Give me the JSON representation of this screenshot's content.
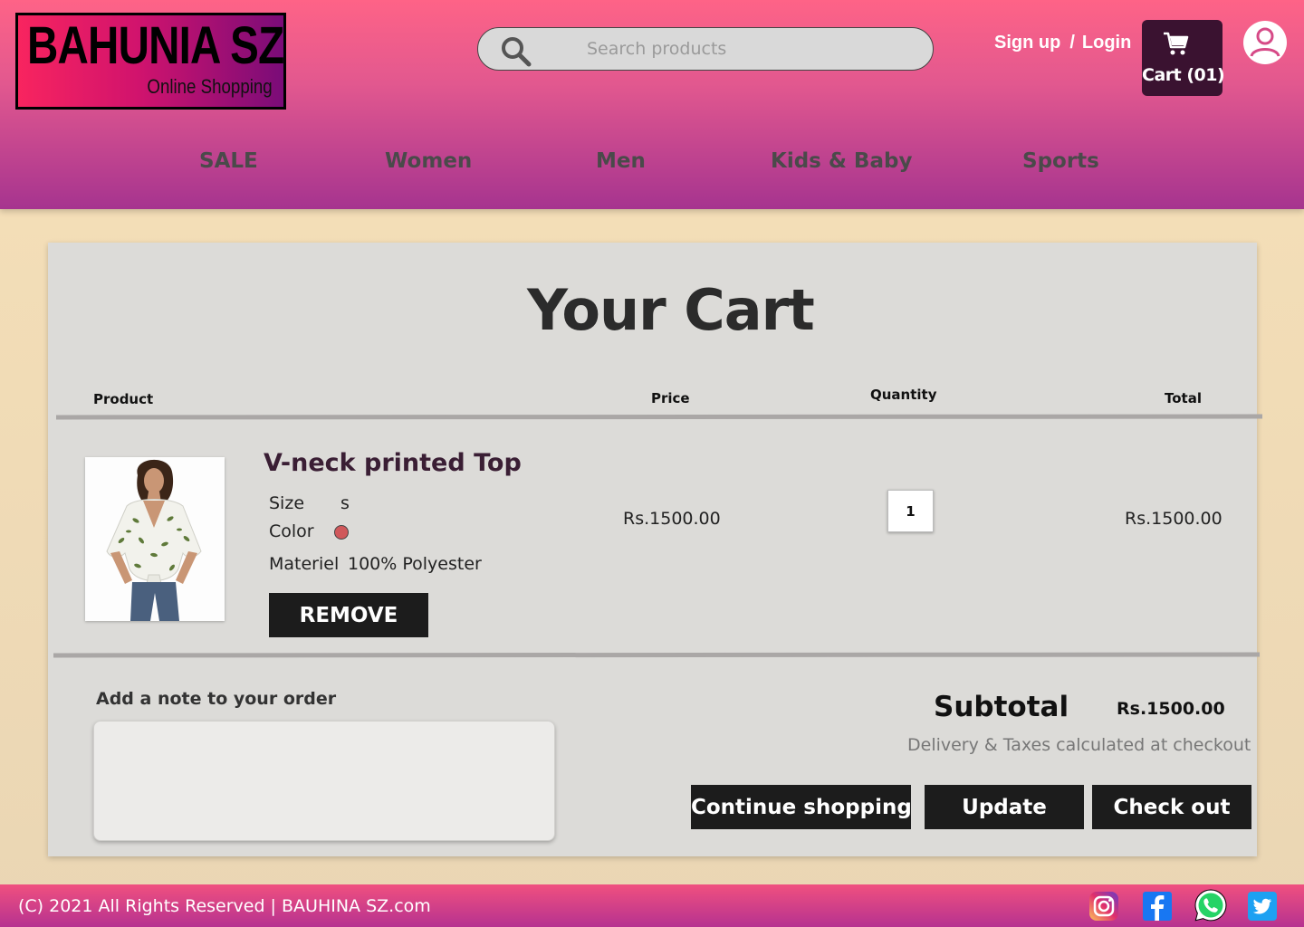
{
  "header": {
    "logo_title": "BAHUNIA SZ",
    "logo_subtitle": "Online Shopping",
    "search_placeholder": "Search products",
    "sign_up": "Sign up",
    "auth_separator": "/",
    "login": "Login",
    "cart_label": "Cart (01)",
    "cart_icon": "shopping-cart-icon",
    "profile_icon": "user-profile-icon"
  },
  "nav": {
    "items": [
      "SALE",
      "Women",
      "Men",
      "Kids & Baby",
      "Sports"
    ]
  },
  "cart": {
    "title": "Your Cart",
    "columns": {
      "product": "Product",
      "price": "Price",
      "quantity": "Quantity",
      "total": "Total"
    },
    "items": [
      {
        "name": "V-neck  printed Top",
        "size_label": "Size",
        "size_value": "s",
        "color_label": "Color",
        "color_hex": "#d0585b",
        "material_label": "Materiel",
        "material_value": "100% Polyester",
        "price": "Rs.1500.00",
        "quantity": "1",
        "total": "Rs.1500.00",
        "remove_label": "REMOVE"
      }
    ],
    "note_label": "Add a note to your order",
    "note_value": "",
    "subtotal_label": "Subtotal",
    "subtotal_value": "Rs.1500.00",
    "tax_note": "Delivery & Taxes calculated at checkout",
    "actions": {
      "continue": "Continue shopping",
      "update": "Update",
      "checkout": "Check out"
    }
  },
  "footer": {
    "copyright": "(C) 2021 All Rights Reserved  | BAUHINA SZ.com",
    "social_icons": [
      "instagram-icon",
      "facebook-icon",
      "whatsapp-icon",
      "twitter-icon"
    ]
  },
  "colors": {
    "header_top": "#fe6387",
    "header_bottom": "#a6348f",
    "page_bg": "#f6e0b8",
    "panel_bg": "#dcdbd8",
    "button_bg": "#1c1c1c",
    "cart_button_bg": "#3a1230"
  }
}
